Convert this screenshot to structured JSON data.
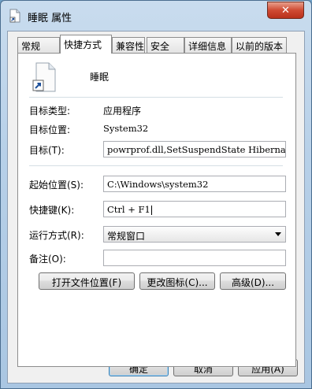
{
  "window": {
    "title": "睡眠 属性",
    "close_label": "✕"
  },
  "tabs": [
    {
      "label": "常规"
    },
    {
      "label": "快捷方式"
    },
    {
      "label": "兼容性"
    },
    {
      "label": "安全"
    },
    {
      "label": "详细信息"
    },
    {
      "label": "以前的版本"
    }
  ],
  "shortcut": {
    "name": "睡眠",
    "target_type_label": "目标类型:",
    "target_type_value": "应用程序",
    "target_location_label": "目标位置:",
    "target_location_value": "System32",
    "target_label": "目标(T):",
    "target_value": "powrprof.dll,SetSuspendState Hibernate",
    "start_in_label": "起始位置(S):",
    "start_in_value": "C:\\Windows\\system32",
    "hotkey_label": "快捷键(K):",
    "hotkey_value": "Ctrl + F1",
    "run_label": "运行方式(R):",
    "run_value": "常规窗口",
    "comment_label": "备注(O):",
    "comment_value": "",
    "open_location_button": "打开文件位置(F)",
    "change_icon_button": "更改图标(C)...",
    "advanced_button": "高级(D)..."
  },
  "footer": {
    "ok_button": "确定",
    "cancel_button": "取消",
    "apply_button": "应用(A)"
  },
  "colors": {
    "highlight_box": "#e0303a",
    "annotation_arrow": "#e8323c"
  }
}
